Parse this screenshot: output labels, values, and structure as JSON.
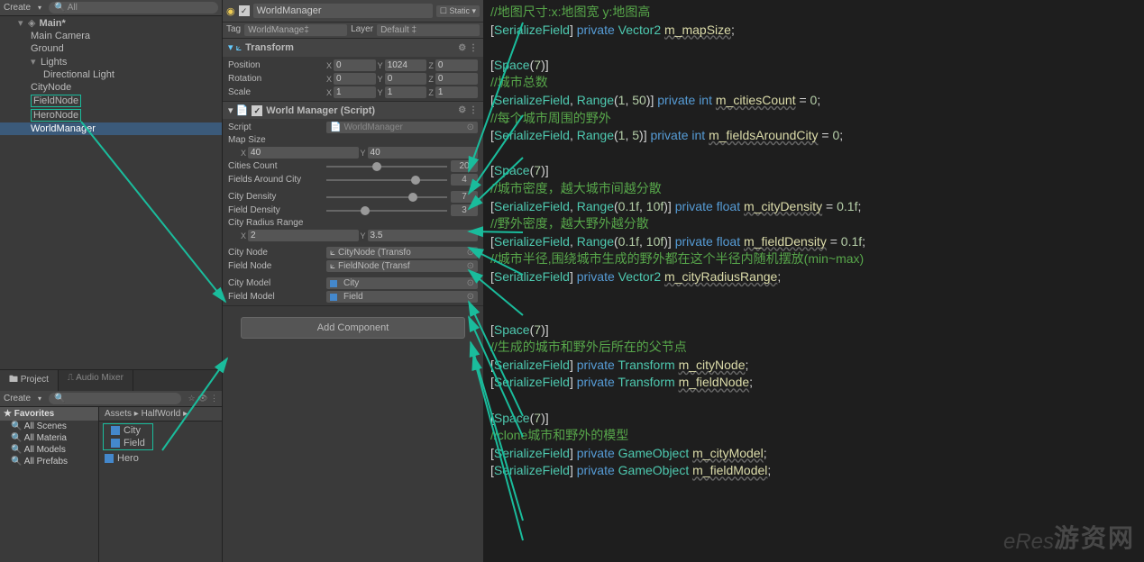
{
  "hierarchy": {
    "create": "Create",
    "search_ph": "All",
    "scene": "Main*",
    "items": [
      "Main Camera",
      "Ground",
      "Lights",
      "Directional Light",
      "CityNode",
      "FieldNode",
      "HeroNode",
      "WorldManager"
    ]
  },
  "project": {
    "tab1": "Project",
    "tab2": "Audio Mixer",
    "create": "Create",
    "fav_header": "Favorites",
    "favs": [
      "All Scenes",
      "All Materia",
      "All Models",
      "All Prefabs"
    ],
    "crumb": "Assets ▸ HalfWorld ▸",
    "assets": [
      "City",
      "Field",
      "Hero"
    ]
  },
  "inspector": {
    "name": "WorldManager",
    "static": "Static",
    "tag_l": "Tag",
    "tag_v": "WorldManage",
    "layer_l": "Layer",
    "layer_v": "Default",
    "transform": {
      "title": "Transform",
      "pos_l": "Position",
      "px": "0",
      "py": "1024",
      "pz": "0",
      "rot_l": "Rotation",
      "rx": "0",
      "ry": "0",
      "rz": "0",
      "scl_l": "Scale",
      "sx": "1",
      "sy": "1",
      "sz": "1"
    },
    "wm": {
      "title": "World Manager (Script)",
      "script_l": "Script",
      "script_v": "WorldManager",
      "mapsize_l": "Map Size",
      "msx": "40",
      "msy": "40",
      "cities_l": "Cities Count",
      "cities_v": "20",
      "fac_l": "Fields Around City",
      "fac_v": "4",
      "cd_l": "City Density",
      "cd_v": "7",
      "fd_l": "Field Density",
      "fd_v": "3",
      "crr_l": "City Radius Range",
      "crrx": "2",
      "crry": "3.5",
      "cn_l": "City Node",
      "cn_v": "CityNode (Transfo",
      "fn_l": "Field Node",
      "fn_v": "FieldNode (Transf",
      "cm_l": "City Model",
      "cm_v": "City",
      "fm_l": "Field Model",
      "fm_v": "Field"
    },
    "add_comp": "Add Component"
  },
  "code": {
    "l1": "//地图尺寸:x:地图宽 y:地图高",
    "l3": "Space",
    "l4": "//城市总数",
    "l6": "//每个城市周围的野外",
    "l8": "//城市密度，越大城市间越分散",
    "l10": "//野外密度，越大野外越分散",
    "l12": "//城市半径,围绕城市生成的野外都在这个半径内随机摆放(min~max)",
    "l14": "//生成的城市和野外后所在的父节点",
    "l17": "//clone城市和野外的模型",
    "sf": "SerializeField",
    "rg": "Range",
    "priv": "private",
    "v2": "Vector2",
    "tr": "Transform",
    "go": "GameObject",
    "int": "int",
    "float": "float",
    "m_mapSize": "m_mapSize",
    "m_citiesCount": "m_citiesCount",
    "m_fieldsAroundCity": "m_fieldsAroundCity",
    "m_cityDensity": "m_cityDensity",
    "m_fieldDensity": "m_fieldDensity",
    "m_cityRadiusRange": "m_cityRadiusRange",
    "m_cityNode": "m_cityNode",
    "m_fieldNode": "m_fieldNode",
    "m_cityModel": "m_cityModel",
    "m_fieldModel": "m_fieldModel"
  },
  "watermark": "游资网",
  "watermark2": "eRes"
}
